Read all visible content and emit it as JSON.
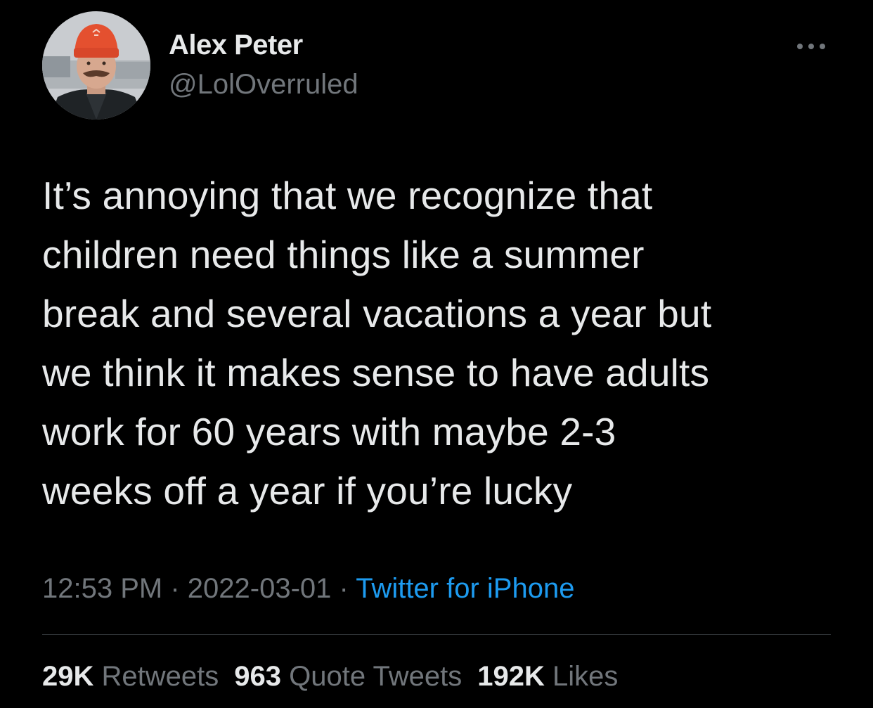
{
  "author": {
    "name": "Alex Peter",
    "handle": "@LolOverruled"
  },
  "tweet": {
    "text": "It’s annoying that we recognize that\nchildren need things like a summer\nbreak and several vacations a year but\nwe think it makes sense to have adults\nwork for 60 years with maybe 2-3\nweeks off a year if you’re lucky",
    "time": "12:53 PM",
    "separator": " · ",
    "date": "2022-03-01",
    "source": "Twitter for iPhone"
  },
  "stats": {
    "retweets_count": "29K",
    "retweets_label": "Retweets",
    "quotes_count": "963",
    "quotes_label": "Quote Tweets",
    "likes_count": "192K",
    "likes_label": "Likes"
  },
  "icons": {
    "more": "more-horizontal-icon",
    "avatar": "profile-photo"
  },
  "colors": {
    "background": "#000000",
    "text_primary": "#e7e9ea",
    "text_secondary": "#71767b",
    "link": "#1d9bf0",
    "divider": "#2f3336"
  }
}
